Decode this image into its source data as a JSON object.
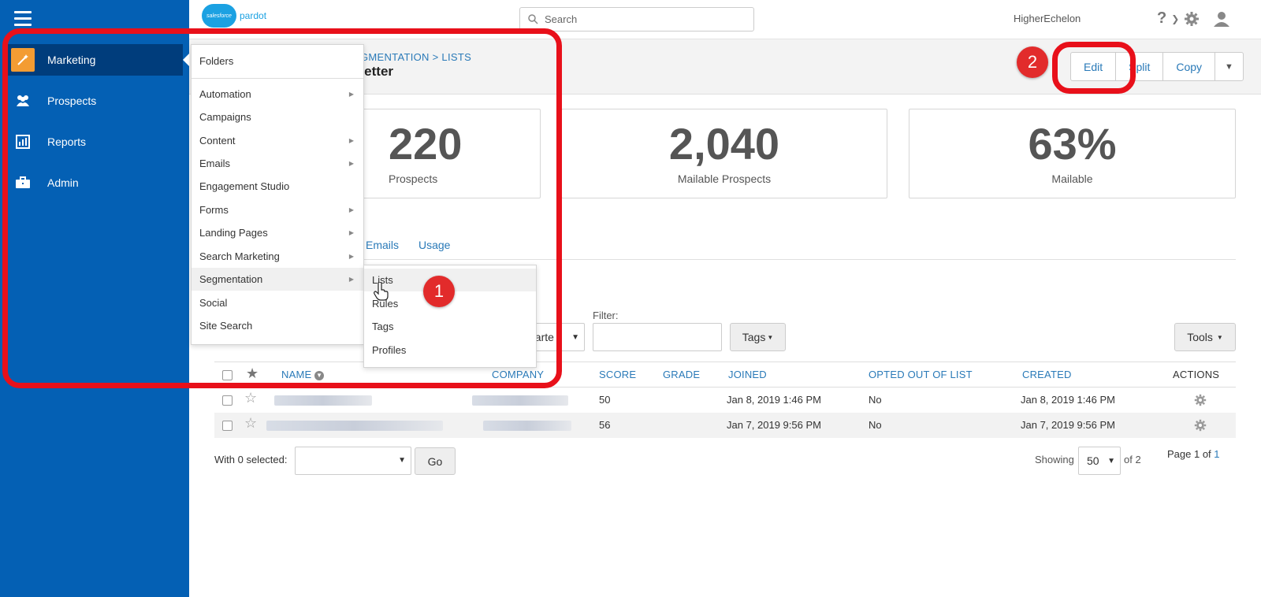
{
  "sidebar": {
    "items": [
      {
        "label": "Marketing",
        "icon": "wand-icon"
      },
      {
        "label": "Prospects",
        "icon": "people-icon"
      },
      {
        "label": "Reports",
        "icon": "chart-icon"
      },
      {
        "label": "Admin",
        "icon": "briefcase-icon"
      }
    ]
  },
  "topbar": {
    "logo_cloud": "salesforce",
    "logo_text": "pardot",
    "search_placeholder": "Search",
    "org_name": "HigherEchelon"
  },
  "header": {
    "breadcrumb": "EGMENTATION > LISTS",
    "title": "sletter",
    "buttons": [
      "Edit",
      "Split",
      "Copy"
    ]
  },
  "stats": [
    {
      "value": "220",
      "label": "Prospects"
    },
    {
      "value": "2,040",
      "label": "Mailable Prospects"
    },
    {
      "value": "63%",
      "label": "Mailable"
    }
  ],
  "tabs": [
    "Emails",
    "Usage"
  ],
  "filters": {
    "select_partial_value": "uarte",
    "filter_label": "Filter:",
    "tags_label": "Tags",
    "tools_label": "Tools"
  },
  "table": {
    "headers": [
      "NAME",
      "COMPANY",
      "SCORE",
      "GRADE",
      "JOINED",
      "OPTED OUT OF LIST",
      "CREATED",
      "ACTIONS"
    ],
    "rows": [
      {
        "score": "50",
        "grade": "",
        "joined": "Jan 8, 2019 1:46 PM",
        "opted_out": "No",
        "created": "Jan 8, 2019 1:46 PM"
      },
      {
        "score": "56",
        "grade": "",
        "joined": "Jan 7, 2019 9:56 PM",
        "opted_out": "No",
        "created": "Jan 7, 2019 9:56 PM"
      }
    ]
  },
  "footer": {
    "with_selected": "With 0 selected:",
    "go_label": "Go",
    "showing_label": "Showing",
    "per_page": "50",
    "of_total": "of 2",
    "page_prefix": "Page 1 of",
    "page_total": "1"
  },
  "menu": {
    "items": [
      {
        "label": "Folders",
        "sub": false
      },
      {
        "label": "Automation",
        "sub": true
      },
      {
        "label": "Campaigns",
        "sub": false
      },
      {
        "label": "Content",
        "sub": true
      },
      {
        "label": "Emails",
        "sub": true
      },
      {
        "label": "Engagement Studio",
        "sub": false
      },
      {
        "label": "Forms",
        "sub": true
      },
      {
        "label": "Landing Pages",
        "sub": true
      },
      {
        "label": "Search Marketing",
        "sub": true
      },
      {
        "label": "Segmentation",
        "sub": true
      },
      {
        "label": "Social",
        "sub": false
      },
      {
        "label": "Site Search",
        "sub": false
      }
    ],
    "submenu": [
      "Lists",
      "Rules",
      "Tags",
      "Profiles"
    ]
  },
  "annotations": {
    "badge_1": "1",
    "badge_2": "2",
    "highlight_color": "#e8101a"
  },
  "colors": {
    "sidebar": "#0460b4",
    "sidebar_active": "#003d7c",
    "accent": "#f39c33",
    "link": "#2a7ab8"
  }
}
